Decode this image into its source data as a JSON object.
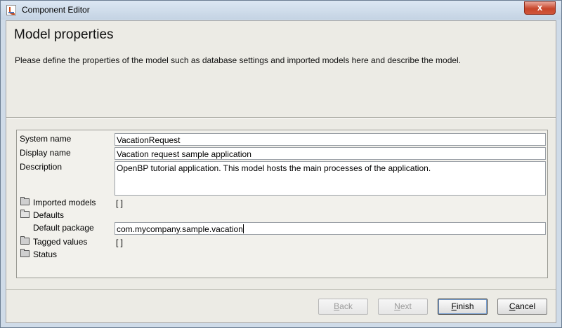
{
  "window": {
    "title": "Component Editor",
    "close_symbol": "x"
  },
  "page": {
    "heading": "Model properties",
    "description": "Please define the properties of the model such as database settings and imported models here and describe the model."
  },
  "properties": {
    "system_name": {
      "label": "System name",
      "value": "VacationRequest"
    },
    "display_name": {
      "label": "Display name",
      "value": "Vacation request sample application"
    },
    "description": {
      "label": "Description",
      "value": "OpenBP tutorial application. This model hosts the main processes of the application."
    },
    "imported_models": {
      "label": "Imported models",
      "value": "[ ]"
    },
    "defaults": {
      "label": "Defaults"
    },
    "default_package": {
      "label": "Default package",
      "value": "com.mycompany.sample.vacation"
    },
    "tagged_values": {
      "label": "Tagged values",
      "value": "[ ]"
    },
    "status": {
      "label": "Status"
    }
  },
  "buttons": {
    "back": {
      "mnemonic": "B",
      "rest": "ack",
      "enabled": false
    },
    "next": {
      "mnemonic": "N",
      "rest": "ext",
      "enabled": false
    },
    "finish": {
      "mnemonic": "F",
      "rest": "inish",
      "enabled": true
    },
    "cancel": {
      "mnemonic": "C",
      "rest": "ancel",
      "enabled": true
    }
  }
}
